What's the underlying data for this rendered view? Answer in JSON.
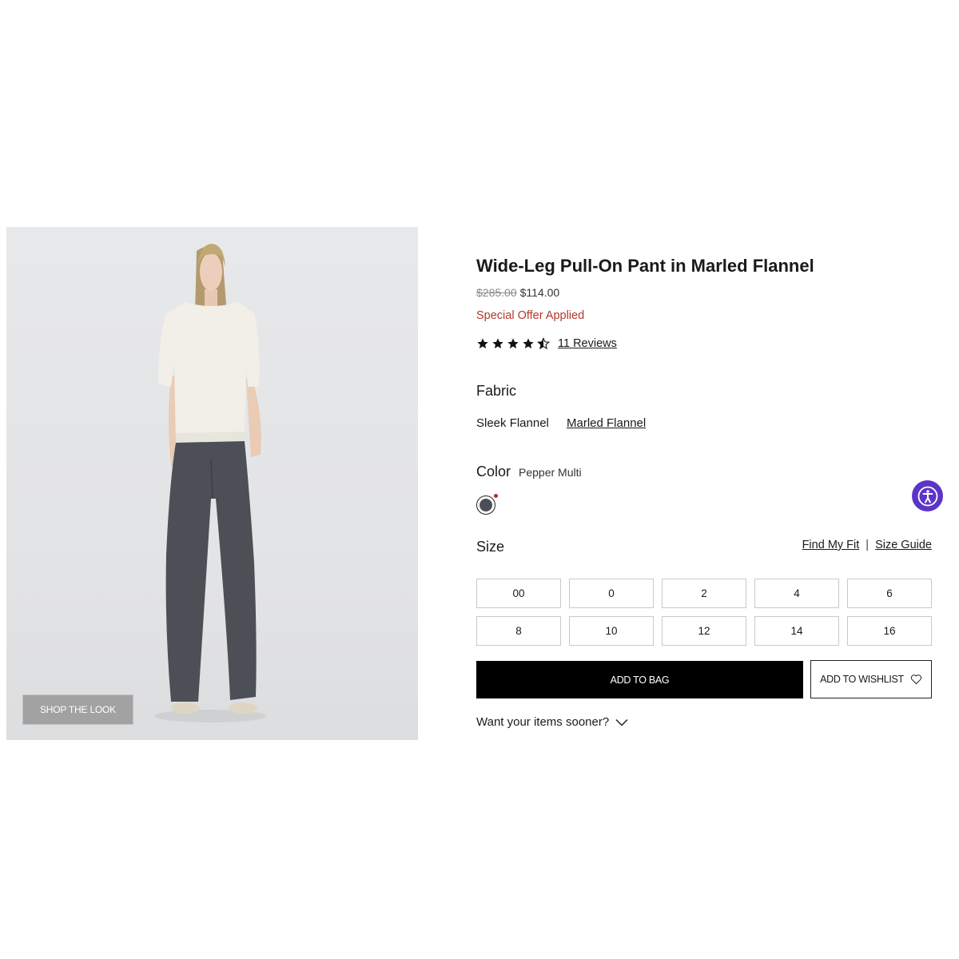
{
  "product": {
    "title": "Wide-Leg Pull-On Pant in Marled Flannel",
    "price_original": "$285.00",
    "price_sale": "$114.00",
    "offer": "Special Offer Applied",
    "rating": 4.5,
    "reviews_label": "11 Reviews"
  },
  "image": {
    "shop_the_look": "SHOP THE LOOK"
  },
  "fabric": {
    "label": "Fabric",
    "options": [
      {
        "label": "Sleek Flannel",
        "selected": false
      },
      {
        "label": "Marled Flannel",
        "selected": true
      }
    ]
  },
  "color": {
    "label": "Color",
    "value": "Pepper Multi",
    "swatch_color": "#4a4f55"
  },
  "size": {
    "label": "Size",
    "find_my_fit": "Find My Fit",
    "separator": "|",
    "size_guide": "Size Guide",
    "options": [
      "00",
      "0",
      "2",
      "4",
      "6",
      "8",
      "10",
      "12",
      "14",
      "16"
    ]
  },
  "actions": {
    "add_to_bag": "ADD TO BAG",
    "add_to_wishlist": "ADD TO WISHLIST",
    "want_sooner": "Want your items sooner?"
  },
  "colors": {
    "offer_red": "#b6362a",
    "accessibility_purple": "#5b35c8",
    "button_black": "#000000"
  },
  "icons": {
    "heart": "heart-icon",
    "chevron": "chevron-down-icon",
    "accessibility": "accessibility-icon",
    "star": "star-icon"
  }
}
